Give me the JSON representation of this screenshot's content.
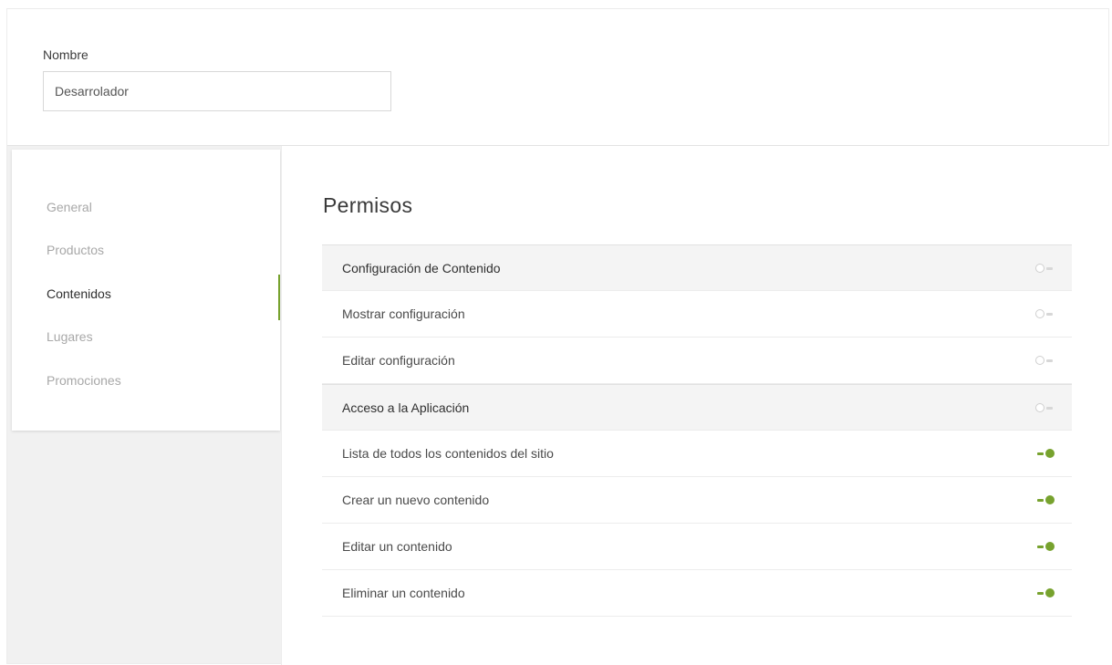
{
  "header": {
    "name_label": "Nombre",
    "name_value": "Desarrolador"
  },
  "sidebar": {
    "items": [
      {
        "label": "General",
        "active": false
      },
      {
        "label": "Productos",
        "active": false
      },
      {
        "label": "Contenidos",
        "active": true
      },
      {
        "label": "Lugares",
        "active": false
      },
      {
        "label": "Promociones",
        "active": false
      }
    ]
  },
  "main": {
    "title": "Permisos",
    "permissions": [
      {
        "label": "Configuración de Contenido",
        "group": true,
        "enabled": false
      },
      {
        "label": "Mostrar configuración",
        "group": false,
        "enabled": false
      },
      {
        "label": "Editar configuración",
        "group": false,
        "enabled": false
      },
      {
        "label": "Acceso a la Aplicación",
        "group": true,
        "enabled": false
      },
      {
        "label": "Lista de todos los contenidos del sitio",
        "group": false,
        "enabled": true
      },
      {
        "label": "Crear un nuevo contenido",
        "group": false,
        "enabled": true
      },
      {
        "label": "Editar un contenido",
        "group": false,
        "enabled": true
      },
      {
        "label": "Eliminar un contenido",
        "group": false,
        "enabled": true
      }
    ]
  },
  "colors": {
    "accent": "#77a22e",
    "toggle_off": "#cfcfcf"
  },
  "icons": {
    "toggle_on": "toggle-on-icon",
    "toggle_off": "toggle-off-icon"
  }
}
